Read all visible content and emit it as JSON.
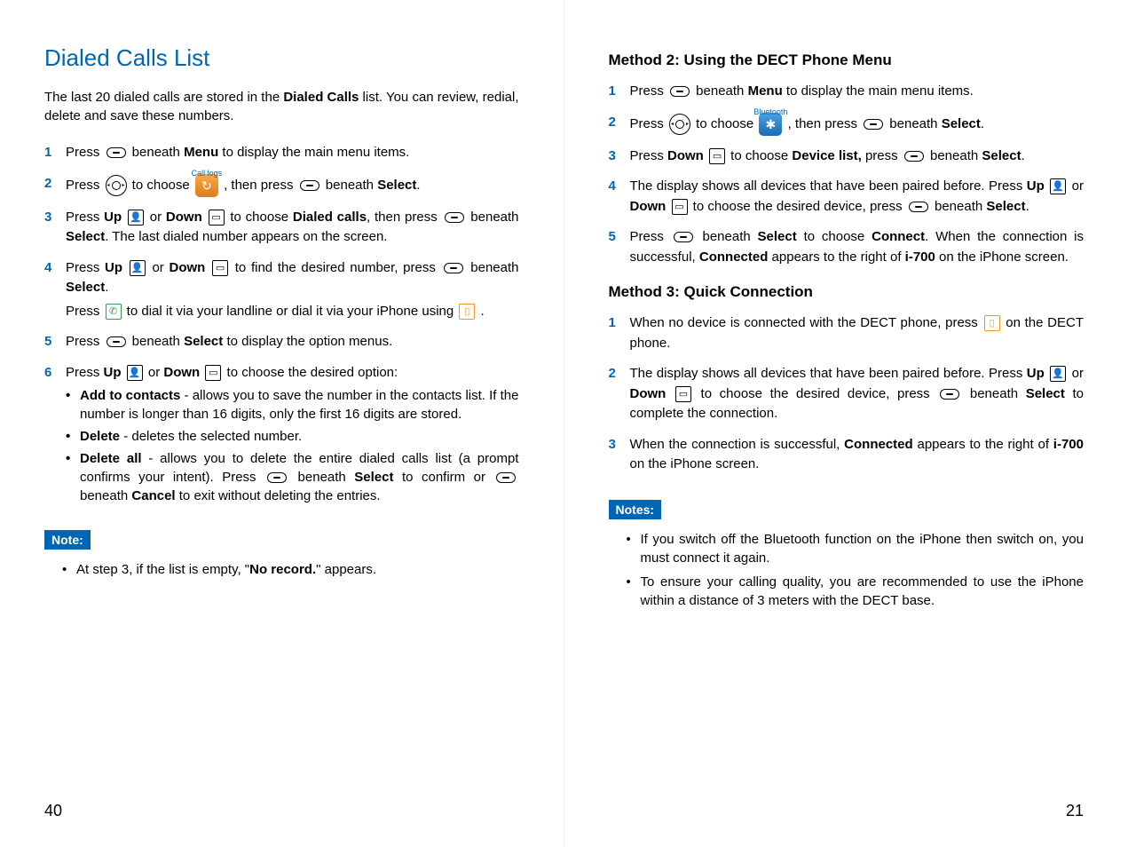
{
  "left_page": {
    "title": "Dialed Calls List",
    "intro_prefix": "The last 20 dialed calls are stored in the ",
    "intro_bold": "Dialed Calls",
    "intro_suffix": " list. You can review, redial, delete and save these numbers.",
    "steps": {
      "s1_a": "Press ",
      "s1_b": " beneath ",
      "s1_menu": "Menu",
      "s1_c": " to display the main menu items.",
      "s2_a": "Press ",
      "s2_b": " to choose ",
      "s2_caption": "Call logs",
      "s2_c": " , then press ",
      "s2_d": " beneath ",
      "s2_select": "Select",
      "s2_e": ".",
      "s3_a": "Press ",
      "s3_up": "Up",
      "s3_b": " or ",
      "s3_down": "Down",
      "s3_c": " to choose ",
      "s3_dialed": "Dialed calls",
      "s3_d": ", then press ",
      "s3_e": " beneath ",
      "s3_select": "Select",
      "s3_f": ". The last dialed number appears on the screen.",
      "s4_a": "Press ",
      "s4_up": "Up",
      "s4_b": " or ",
      "s4_down": "Down",
      "s4_c": " to find the desired number, press ",
      "s4_d": " beneath ",
      "s4_select": "Select",
      "s4_e": ".",
      "s4_sub_a": "Press ",
      "s4_sub_b": " to dial it via your landline or dial it via your iPhone using ",
      "s4_sub_c": " .",
      "s5_a": "Press ",
      "s5_b": " beneath ",
      "s5_select": "Select",
      "s5_c": " to display the option menus.",
      "s6_a": "Press ",
      "s6_up": "Up",
      "s6_b": " or ",
      "s6_down": "Down",
      "s6_c": " to choose the desired option:",
      "s6_opt1_b": "Add to contacts",
      "s6_opt1_t": " - allows you to save the number in the contacts list. If the number is longer than 16 digits, only the first 16 digits are stored.",
      "s6_opt2_b": "Delete",
      "s6_opt2_t": " - deletes the selected number.",
      "s6_opt3_b": "Delete all",
      "s6_opt3_t1": " - allows you to delete the entire dialed calls list (a prompt confirms your intent). Press ",
      "s6_opt3_t2": " beneath ",
      "s6_opt3_select": "Select",
      "s6_opt3_t3": " to confirm or ",
      "s6_opt3_t4": " beneath ",
      "s6_opt3_cancel": "Cancel",
      "s6_opt3_t5": " to exit without deleting the entries."
    },
    "note_label": "Note:",
    "note_text_a": "At step 3, if the list is empty, \"",
    "note_text_b": "No record.",
    "note_text_c": "\" appears.",
    "page_number": "40"
  },
  "right_page": {
    "method2_title": "Method 2: Using the DECT Phone Menu",
    "m2": {
      "s1_a": "Press ",
      "s1_b": " beneath ",
      "s1_menu": "Menu",
      "s1_c": " to display the main menu items.",
      "s2_a": "Press ",
      "s2_b": " to choose ",
      "s2_caption": "Bluetooth",
      "s2_c": " , then press ",
      "s2_d": " beneath ",
      "s2_select": "Select",
      "s2_e": ".",
      "s3_a": "Press ",
      "s3_down": "Down",
      "s3_b": " to choose ",
      "s3_device": "Device list,",
      "s3_c": " press ",
      "s3_d": " beneath ",
      "s3_select": "Select",
      "s3_e": ".",
      "s4_a": "The display shows all devices that have been paired before. Press ",
      "s4_up": "Up",
      "s4_b": " or ",
      "s4_down": "Down",
      "s4_c": " to choose the desired device, press ",
      "s4_d": " beneath ",
      "s4_select": "Select",
      "s4_e": ".",
      "s5_a": "Press ",
      "s5_b": " beneath ",
      "s5_select": "Select",
      "s5_c": " to choose ",
      "s5_connect": "Connect",
      "s5_d": ". When the connection is successful, ",
      "s5_connected": "Connected",
      "s5_e": " appears to the right of ",
      "s5_i700": "i-700",
      "s5_f": " on the iPhone screen."
    },
    "method3_title": "Method 3: Quick Connection",
    "m3": {
      "s1_a": "When no device is connected with the DECT phone, press ",
      "s1_b": " on the DECT phone.",
      "s2_a": "The display shows all devices that have been paired before. Press ",
      "s2_up": "Up",
      "s2_b": " or ",
      "s2_down": "Down",
      "s2_c": " to choose the desired device, press ",
      "s2_d": " beneath ",
      "s2_select": "Select",
      "s2_e": " to complete the connection.",
      "s3_a": "When the connection is successful, ",
      "s3_connected": "Connected",
      "s3_b": " appears to the right of ",
      "s3_i700": "i-700",
      "s3_c": " on the iPhone screen."
    },
    "notes_label": "Notes:",
    "note1": "If you switch off the Bluetooth function on the iPhone then switch on, you must connect it again.",
    "note2": "To ensure your calling quality, you are recommended to use the iPhone within a distance of 3 meters with the DECT base.",
    "page_number": "21"
  }
}
